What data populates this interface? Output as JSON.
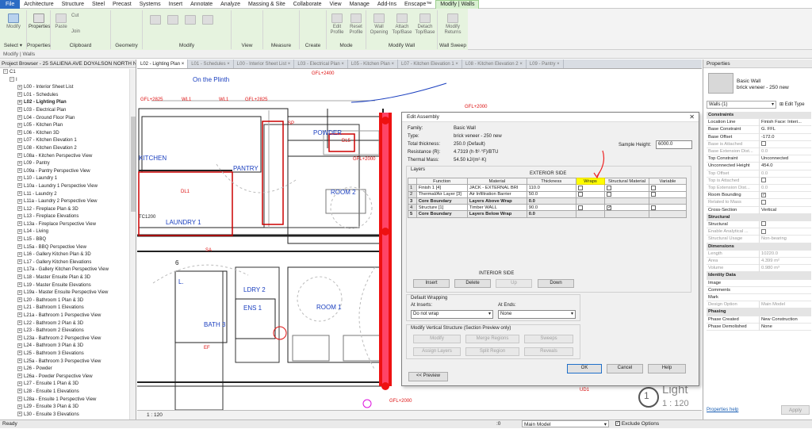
{
  "menu": {
    "items": [
      "File",
      "Architecture",
      "Structure",
      "Steel",
      "Precast",
      "Systems",
      "Insert",
      "Annotate",
      "Analyze",
      "Massing & Site",
      "Collaborate",
      "View",
      "Manage",
      "Add-Ins",
      "Enscape™",
      "Modify | Walls"
    ],
    "active": "Modify | Walls"
  },
  "ribbon": {
    "groups": [
      {
        "label": "Select",
        "buttons": [
          "Modify"
        ]
      },
      {
        "label": "Properties",
        "buttons": [
          "Properties"
        ]
      },
      {
        "label": "Clipboard",
        "buttons": [
          "Paste",
          "Cut",
          "Join"
        ]
      },
      {
        "label": "Geometry",
        "buttons": []
      },
      {
        "label": "Modify",
        "buttons": []
      },
      {
        "label": "View",
        "buttons": []
      },
      {
        "label": "Measure",
        "buttons": []
      },
      {
        "label": "Create",
        "buttons": []
      },
      {
        "label": "Mode",
        "buttons": [
          "Edit Profile",
          "Reset Profile"
        ]
      },
      {
        "label": "Modify Wall",
        "buttons": [
          "Wall Opening",
          "Attach Top/Base",
          "Detach Top/Base"
        ]
      },
      {
        "label": "Wall Sweep",
        "buttons": [
          "Modify Returns"
        ]
      }
    ],
    "select_label": "Select ▾"
  },
  "context_bar": "Modify | Walls",
  "project_browser": {
    "title": "Project Browser - 25 SALIENA AVE DOYALSON NORTH NS...",
    "root": "C1",
    "sub": "I",
    "items": [
      "L00 - Interior Sheet List",
      "L01 - Schedules",
      "L02 - Lighting Plan",
      "L03 - Electrical Plan",
      "L04 - Ground Floor Plan",
      "L05 - Kitchen Plan",
      "L06 - Kitchen 3D",
      "L07 - Kitchen Elevation 1",
      "L08 - Kitchen Elevation 2",
      "L08a - Kitchen Perspective View",
      "L09 - Pantry",
      "L09a - Pantry Perspective View",
      "L10 - Laundry 1",
      "L10a - Laundry 1 Perspective View",
      "L11 - Laundry 2",
      "L11a - Laundry 2 Perspective View",
      "L12 - Fireplace Plan & 3D",
      "L13 - Fireplace Elevations",
      "L13a - Fireplace Perspective View",
      "L14 - Living",
      "L15 - BBQ",
      "L15a - BBQ Perspective View",
      "L16 - Gallery Kitchen Plan & 3D",
      "L17 - Gallery Kitchen Elevations",
      "L17a - Gallery Kitchen Perspective View",
      "L18 - Master Ensuite Plan & 3D",
      "L19 - Master Ensuite Elevations",
      "L19a - Master Ensuite Perspective View",
      "L20 - Bathroom 1 Plan & 3D",
      "L21 - Bathroom 1 Elevations",
      "L21a - Bathroom 1 Perspective View",
      "L22 - Bathroom 2 Plan & 3D",
      "L23 - Bathroom 2 Elevations",
      "L23a - Bathroom 2 Perspective View",
      "L24 - Bathroom 3 Plan & 3D",
      "L25 - Bathroom 3 Elevations",
      "L25a - Bathroom 3 Perspective View",
      "L26 - Powder",
      "L26a - Powder Perspective View",
      "L27 - Ensuite 1 Plan & 3D",
      "L28 - Ensuite 1 Elevations",
      "L28a - Ensuite 1 Perspective View",
      "L29 - Ensuite 3 Plan & 3D",
      "L30 - Ensuite 3 Elevations"
    ],
    "selected": "L02 - Lighting Plan"
  },
  "view_tabs": [
    "L02 - Lighting Plan",
    "L01 - Schedules",
    "L00 - Interior Sheet List",
    "L03 - Electrical Plan",
    "L05 - Kitchen Plan",
    "L07 - Kitchen Elevation 1",
    "L08 - Kitchen Elevation 2",
    "L09 - Pantry"
  ],
  "drawing": {
    "rooms": [
      "KITCHEN",
      "PANTRY",
      "ROOM 2",
      "POWDER",
      "LAUNDRY 1",
      "L.",
      "LDRY 2",
      "ENS 1",
      "ROOM 1",
      "BATH 3"
    ],
    "labels": [
      "On the Plinth",
      "GFL+2400",
      "GFL+2825",
      "WL1",
      "WL1",
      "GFL+2825",
      "GFL+2000",
      "GFL+2000",
      "GFL+2000",
      "DL1",
      "EF",
      "SP",
      "SA",
      "TC1200",
      "UD1",
      "DL5",
      "6"
    ],
    "view_title": "Light",
    "view_scale": "1 : 120",
    "view_number": "1"
  },
  "view_status": {
    "scale": "1 : 120"
  },
  "edit_assembly": {
    "title": "Edit Assembly",
    "family_label": "Family:",
    "family": "Basic Wall",
    "type_label": "Type:",
    "type": "brick veneer - 250 new",
    "thickness_label": "Total thickness:",
    "thickness": "250.0 (Default)",
    "resistance_label": "Resistance (R):",
    "resistance": "4.7319 (h·ft²·°F)/BTU",
    "mass_label": "Thermal Mass:",
    "mass": "54.50 kJ/(m²·K)",
    "sample_height_label": "Sample Height:",
    "sample_height": "6000.0",
    "layers_label": "Layers",
    "exterior_side": "EXTERIOR SIDE",
    "interior_side": "INTERIOR SIDE",
    "columns": [
      "Function",
      "Material",
      "Thickness",
      "Wraps",
      "Structural Material",
      "Variable"
    ],
    "rows": [
      {
        "n": "1",
        "function": "Finish 1 [4]",
        "material": "JACK - EXTERNAL BRI",
        "thickness": "110.0",
        "core": false,
        "wraps": true,
        "structural": false,
        "variable": true
      },
      {
        "n": "2",
        "function": "Thermal/Air Layer [3]",
        "material": "Air Infiltration Barrier",
        "thickness": "50.0",
        "core": false,
        "wraps": true,
        "structural": false,
        "variable": true
      },
      {
        "n": "3",
        "function": "Core Boundary",
        "material": "Layers Above Wrap",
        "thickness": "0.0",
        "core": true
      },
      {
        "n": "4",
        "function": "Structure [1]",
        "material": "Timber WALL",
        "thickness": "90.0",
        "core": false,
        "wraps": false,
        "structural": true,
        "variable": true
      },
      {
        "n": "5",
        "function": "Core Boundary",
        "material": "Layers Below Wrap",
        "thickness": "0.0",
        "core": true
      }
    ],
    "layer_buttons": [
      "Insert",
      "Delete",
      "Up",
      "Down"
    ],
    "default_wrapping": "Default Wrapping",
    "at_inserts_label": "At Inserts:",
    "at_inserts": "Do not wrap",
    "at_ends_label": "At Ends:",
    "at_ends": "None",
    "modify_vertical": "Modify Vertical Structure (Section Preview only)",
    "vertical_buttons": [
      "Modify",
      "Merge Regions",
      "Sweeps",
      "Assign Layers",
      "Split Region",
      "Reveals"
    ],
    "preview": "<< Preview",
    "ok": "OK",
    "cancel": "Cancel",
    "help": "Help"
  },
  "properties": {
    "title": "Properties",
    "family": "Basic Wall",
    "type": "brick veneer - 250 new",
    "selector": "Walls (1)",
    "edit_type": "Edit Type",
    "sections": [
      {
        "name": "Constraints",
        "rows": [
          {
            "k": "Location Line",
            "v": "Finish Face: Interi..."
          },
          {
            "k": "Base Constraint",
            "v": "G. FFL"
          },
          {
            "k": "Base Offset",
            "v": "-172.0"
          },
          {
            "k": "Base is Attached",
            "v": "",
            "dim": true,
            "cb": true
          },
          {
            "k": "Base Extension Dist...",
            "v": "0.0",
            "dim": true
          },
          {
            "k": "Top Constraint",
            "v": "Unconnected"
          },
          {
            "k": "Unconnected Height",
            "v": "454.0"
          },
          {
            "k": "Top Offset",
            "v": "0.0",
            "dim": true
          },
          {
            "k": "Top is Attached",
            "v": "",
            "dim": true,
            "cb": true
          },
          {
            "k": "Top Extension Dist...",
            "v": "0.0",
            "dim": true
          },
          {
            "k": "Room Bounding",
            "v": "",
            "cb": true,
            "checked": true
          },
          {
            "k": "Related to Mass",
            "v": "",
            "dim": true,
            "cb": true
          },
          {
            "k": "Cross-Section",
            "v": "Vertical"
          }
        ]
      },
      {
        "name": "Structural",
        "rows": [
          {
            "k": "Structural",
            "v": "",
            "cb": true
          },
          {
            "k": "Enable Analytical ...",
            "v": "",
            "dim": true,
            "cb": true
          },
          {
            "k": "Structural Usage",
            "v": "Non-bearing",
            "dim": true
          }
        ]
      },
      {
        "name": "Dimensions",
        "rows": [
          {
            "k": "Length",
            "v": "10220.0",
            "dim": true
          },
          {
            "k": "Area",
            "v": "4.399 m²",
            "dim": true
          },
          {
            "k": "Volume",
            "v": "0.980 m³",
            "dim": true
          }
        ]
      },
      {
        "name": "Identity Data",
        "rows": [
          {
            "k": "Image",
            "v": ""
          },
          {
            "k": "Comments",
            "v": ""
          },
          {
            "k": "Mark",
            "v": ""
          },
          {
            "k": "Design Option",
            "v": "Main Model",
            "dim": true
          }
        ]
      },
      {
        "name": "Phasing",
        "rows": [
          {
            "k": "Phase Created",
            "v": "New Construction"
          },
          {
            "k": "Phase Demolished",
            "v": "None"
          }
        ]
      }
    ],
    "help_link": "Properties help",
    "apply": "Apply"
  },
  "status": {
    "ready": "Ready",
    "zero": ":0",
    "model": "Main Model",
    "exclude": "Exclude Options"
  },
  "colors": {
    "accent": "#2b6cc4",
    "ribbon_context": "#e6f3df",
    "cad_red": "#dd1111",
    "cad_blue": "#1a3fbf",
    "wraps_highlight": "#ffff00"
  }
}
